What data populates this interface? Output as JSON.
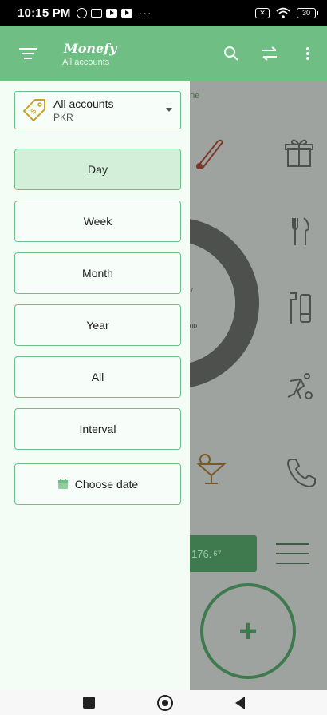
{
  "status_bar": {
    "time": "10:15 PM",
    "dots": "···",
    "battery": "30"
  },
  "header": {
    "brand": "Monefy",
    "subtitle": "All accounts"
  },
  "main": {
    "period_label": "une",
    "donut_value_1": "7",
    "donut_value_2": "00",
    "balance_main": "176.",
    "balance_decimals": "67"
  },
  "drawer": {
    "account": {
      "name": "All accounts",
      "currency": "PKR"
    },
    "periods": [
      "Day",
      "Week",
      "Month",
      "Year",
      "All",
      "Interval"
    ],
    "active_period": "Day",
    "choose_date_label": "Choose date"
  },
  "colors": {
    "primary": "#6fbf84",
    "drawer_bg": "#f3fcf5",
    "active_period_bg": "#d3efd9",
    "scrim": "#9fa39f",
    "gift_yellow": "#c6a52a"
  }
}
